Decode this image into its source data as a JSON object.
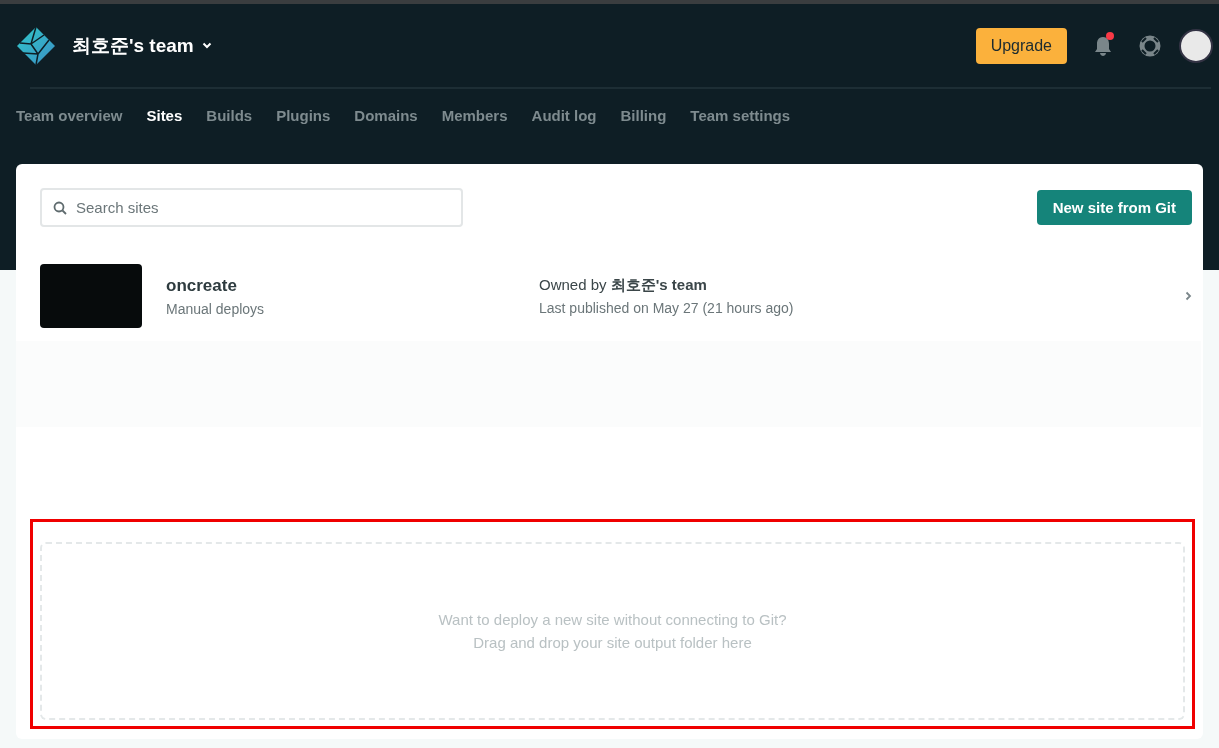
{
  "header": {
    "team_name": "최호준's team",
    "upgrade_button": "Upgrade",
    "notifications_unread": true
  },
  "nav": [
    {
      "label": "Team overview",
      "selected": false
    },
    {
      "label": "Sites",
      "selected": true
    },
    {
      "label": "Builds",
      "selected": false
    },
    {
      "label": "Plugins",
      "selected": false
    },
    {
      "label": "Domains",
      "selected": false
    },
    {
      "label": "Members",
      "selected": false
    },
    {
      "label": "Audit log",
      "selected": false
    },
    {
      "label": "Billing",
      "selected": false
    },
    {
      "label": "Team settings",
      "selected": false
    }
  ],
  "search": {
    "placeholder": "Search sites"
  },
  "new_site_button": "New site from Git",
  "sites": [
    {
      "name": "oncreate",
      "deploy_type": "Manual deploys",
      "owner": "Owned by **최호준's team**",
      "last_published": "Last published on May 27 (21 hours ago)"
    }
  ],
  "dropzone": {
    "lines": [
      "Want to deploy a new site without connecting to Git?",
      "Drag and drop your site output folder here"
    ]
  }
}
